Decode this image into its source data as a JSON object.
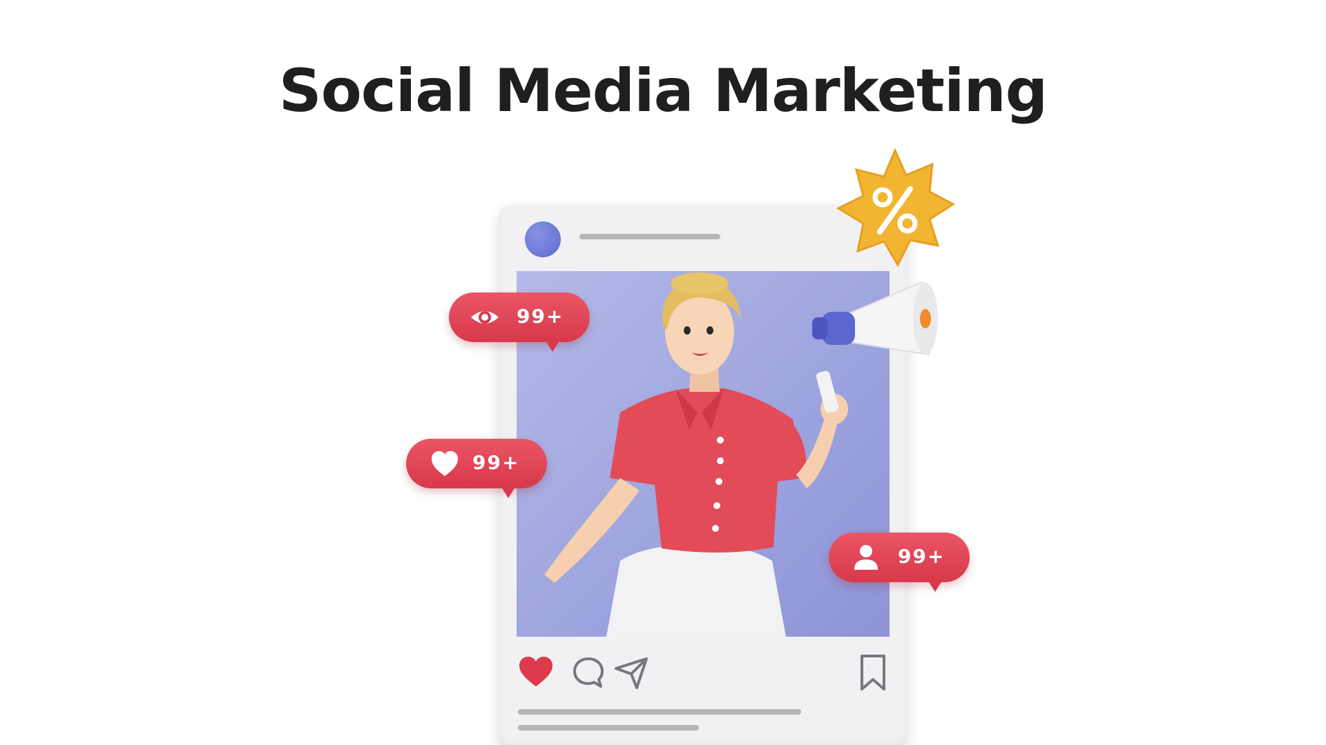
{
  "title": "Social Media Marketing",
  "post": {
    "bubbles": [
      {
        "icon": "eye-icon",
        "count": "99+"
      },
      {
        "icon": "heart-icon",
        "count": "99+"
      },
      {
        "icon": "user-icon",
        "count": "99+"
      }
    ],
    "actions": [
      "heart-icon",
      "comment-icon",
      "send-icon",
      "bookmark-icon"
    ],
    "badge_icon": "percent-badge-icon",
    "megaphone_icon": "megaphone-icon"
  },
  "colors": {
    "accent_red": "#de4153",
    "avatar_blue": "#6b75d6",
    "photo_bg": "#9ea4de",
    "badge_gold": "#f2b531",
    "title": "#1f1f1f"
  }
}
